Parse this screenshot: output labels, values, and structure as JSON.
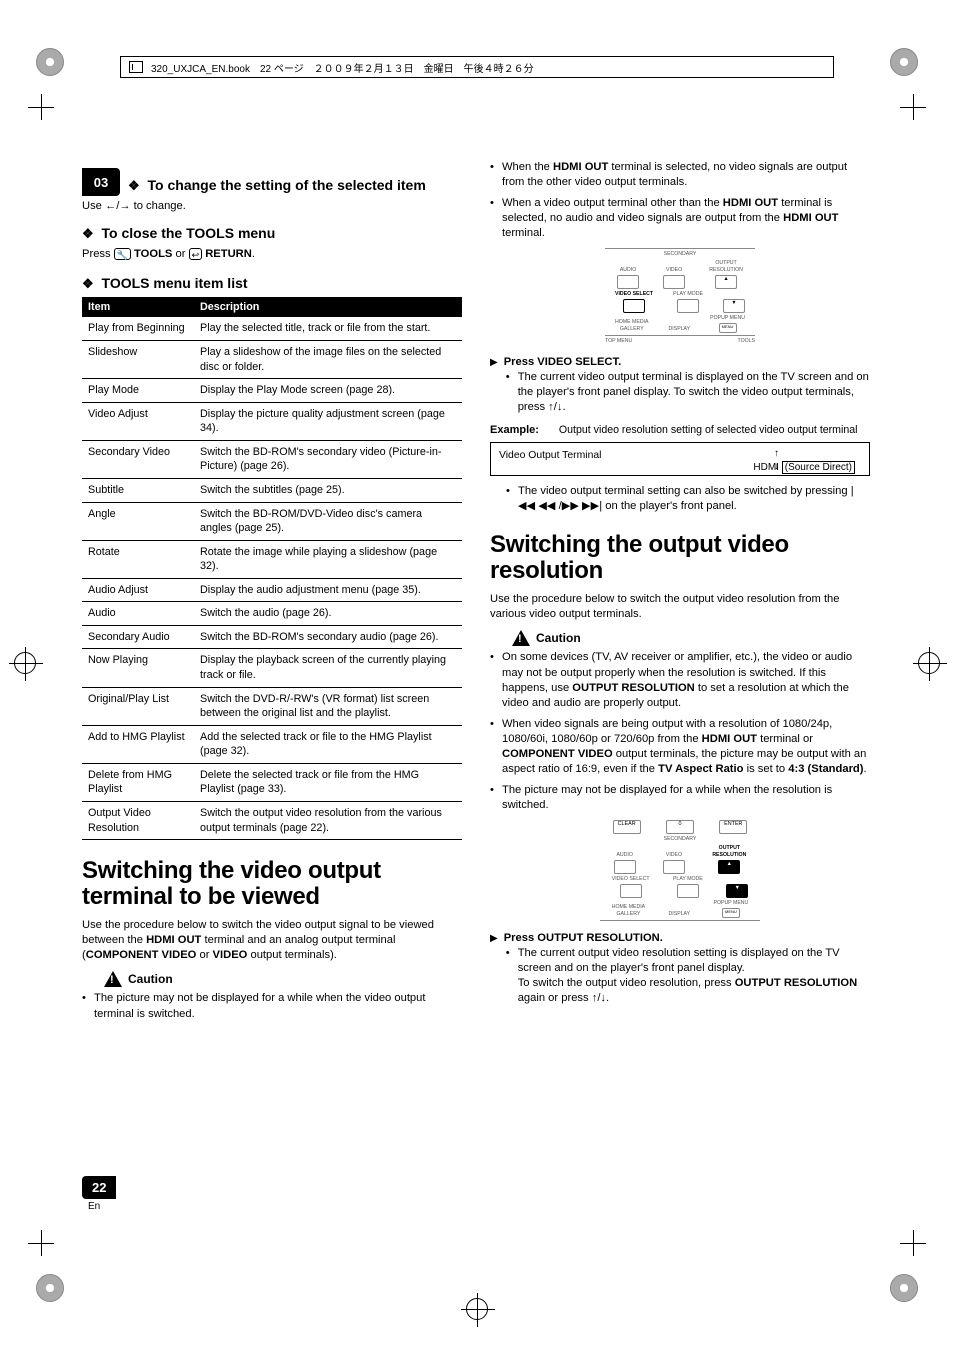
{
  "header_bar": "320_UXJCA_EN.book　22 ページ　２００９年２月１３日　金曜日　午後４時２６分",
  "chapter_tab": "03",
  "sect_change_title": "To change the setting of the selected item",
  "use_arrows_line_pre": "Use ",
  "use_arrows_line_post": " to change.",
  "sect_close_title": "To close the TOOLS menu",
  "press_line_pre": "Press ",
  "tools_btn": "TOOLS",
  "press_or": " or ",
  "return_btn": "RETURN",
  "press_line_post": ".",
  "sect_list_title": "TOOLS menu item list",
  "table_head_item": "Item",
  "table_head_desc": "Description",
  "tools_table": [
    {
      "item": "Play from Beginning",
      "desc": "Play the selected title, track or file from the start."
    },
    {
      "item": "Slideshow",
      "desc": "Play a slideshow of the image files on the selected disc or folder."
    },
    {
      "item": "Play Mode",
      "desc": "Display the Play Mode screen (page 28)."
    },
    {
      "item": "Video Adjust",
      "desc": "Display the picture quality adjustment screen (page 34)."
    },
    {
      "item": "Secondary Video",
      "desc": "Switch the BD-ROM's secondary video (Picture-in-Picture) (page 26)."
    },
    {
      "item": "Subtitle",
      "desc": "Switch the subtitles (page 25)."
    },
    {
      "item": "Angle",
      "desc": "Switch the BD-ROM/DVD-Video disc's camera angles (page 25)."
    },
    {
      "item": "Rotate",
      "desc": "Rotate the image while playing a slideshow (page 32)."
    },
    {
      "item": "Audio Adjust",
      "desc": "Display the audio adjustment menu (page 35)."
    },
    {
      "item": "Audio",
      "desc": "Switch the audio (page 26)."
    },
    {
      "item": "Secondary Audio",
      "desc": "Switch the BD-ROM's secondary audio (page 26)."
    },
    {
      "item": "Now Playing",
      "desc": "Display the playback screen of the currently playing track or file."
    },
    {
      "item": "Original/Play List",
      "desc": "Switch the DVD-R/-RW's (VR format) list screen between the original list and the playlist."
    },
    {
      "item": "Add to HMG Playlist",
      "desc": "Add the selected track or file to the HMG Playlist (page 32)."
    },
    {
      "item": "Delete from HMG Playlist",
      "desc": "Delete the selected track or file from the HMG Playlist (page 33)."
    },
    {
      "item": "Output Video Resolution",
      "desc": "Switch the output video resolution from the various output terminals (page 22)."
    }
  ],
  "h1_switch_terminal": "Switching the video output terminal to be viewed",
  "switch_terminal_para": "Use the procedure below to switch the video output signal to be viewed between the HDMI OUT terminal and an analog output terminal (COMPONENT VIDEO or VIDEO output terminals).",
  "caution_label": "Caution",
  "caution_term_1": "The picture may not be displayed for a while when the video output terminal is switched.",
  "caution_term_2": "When the HDMI OUT terminal is selected, no video signals are output from the other video output terminals.",
  "caution_term_3": "When a video output terminal other than the HDMI OUT terminal is selected, no audio and video signals are output from the HDMI OUT terminal.",
  "remote1": {
    "sec_label": "SECONDARY",
    "audio": "AUDIO",
    "video": "VIDEO",
    "out_res": "OUTPUT\nRESOLUTION",
    "video_select": "VIDEO SELECT",
    "play_mode": "PLAY MODE",
    "hmg": "HOME MEDIA\nGALLERY",
    "display": "DISPLAY",
    "popup": "POPUP MENU",
    "menu_small": "MENU",
    "top_menu": "TOP MENU",
    "tools": "TOOLS"
  },
  "step1_head": "Press VIDEO SELECT.",
  "step1_b1": "The current video output terminal is displayed on the TV screen and on the player's front panel display. To switch the video output terminals, press ↑/↓.",
  "example_label": "Example:",
  "example_desc": "Output video resolution setting of selected video output terminal",
  "osd_terminal": "Video Output Terminal",
  "osd_hdmi": "HDMI",
  "osd_source_direct": "(Source Direct)",
  "step1_b2_pre": "The video output terminal setting can also be switched by pressing ",
  "step1_b2_post": " on the player's front panel.",
  "h1_switch_res": "Switching the output video resolution",
  "switch_res_para": "Use the procedure below to switch the output video resolution from the various video output terminals.",
  "caution_res_1": "On some devices (TV, AV receiver or amplifier, etc.), the video or audio may not be output properly when the resolution is switched. If this happens, use OUTPUT RESOLUTION to set a resolution at which the video and audio are properly output.",
  "caution_res_2": "When video signals are being output with a resolution of 1080/24p, 1080/60i, 1080/60p or 720/60p from the HDMI OUT terminal or COMPONENT VIDEO output terminals, the picture may be output with an aspect ratio of 16:9, even if the TV Aspect Ratio is set to 4:3 (Standard).",
  "caution_res_3": "The picture may not be displayed for a while when the resolution is switched.",
  "remote2": {
    "clear": "CLEAR",
    "zero": "0",
    "enter": "ENTER",
    "sec_label": "SECONDARY",
    "audio": "AUDIO",
    "video": "VIDEO",
    "out_res": "OUTPUT\nRESOLUTION",
    "video_select": "VIDEO SELECT",
    "play_mode": "PLAY MODE",
    "hmg": "HOME MEDIA\nGALLERY",
    "display": "DISPLAY",
    "popup": "POPUP MENU",
    "menu_small": "MENU"
  },
  "step2_head": "Press OUTPUT RESOLUTION.",
  "step2_b1": "The current output video resolution setting is displayed on the TV screen and on the player's front panel display.",
  "step2_b2": "To switch the output video resolution, press OUTPUT RESOLUTION again or press ↑/↓.",
  "page_number": "22",
  "page_lang": "En",
  "bold": {
    "hdmi_out": "HDMI OUT",
    "component_video": "COMPONENT VIDEO",
    "video": "VIDEO",
    "output_resolution": "OUTPUT RESOLUTION",
    "tv_aspect": "TV Aspect Ratio",
    "std43": "4:3 (Standard)"
  },
  "icons": {
    "left_right": "←/→",
    "up_down": "↑/↓",
    "prev_rev_fwd_next": "|◀◀ ◀◀ /▶▶ ▶▶|",
    "tools_glyph": "🔧",
    "return_glyph": "↩"
  }
}
